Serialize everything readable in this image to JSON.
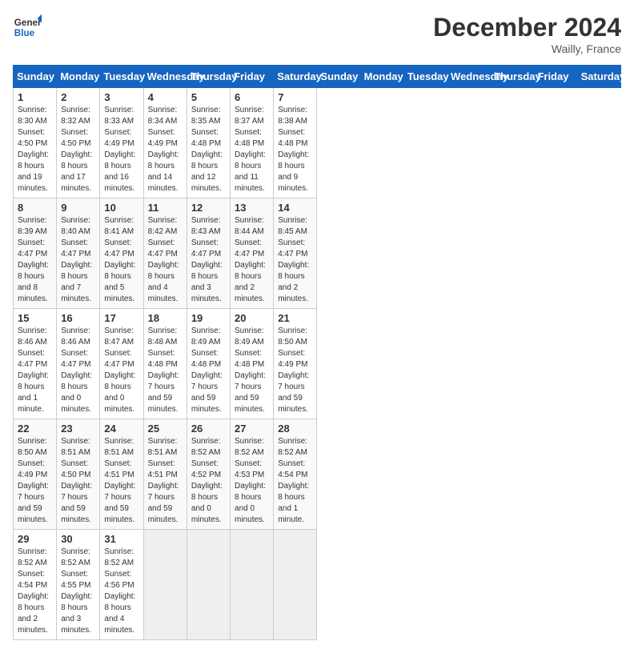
{
  "header": {
    "logo_general": "General",
    "logo_blue": "Blue",
    "month_title": "December 2024",
    "location": "Wailly, France"
  },
  "days_of_week": [
    "Sunday",
    "Monday",
    "Tuesday",
    "Wednesday",
    "Thursday",
    "Friday",
    "Saturday"
  ],
  "weeks": [
    [
      {
        "day": "1",
        "sunrise": "Sunrise: 8:30 AM",
        "sunset": "Sunset: 4:50 PM",
        "daylight": "Daylight: 8 hours and 19 minutes."
      },
      {
        "day": "2",
        "sunrise": "Sunrise: 8:32 AM",
        "sunset": "Sunset: 4:50 PM",
        "daylight": "Daylight: 8 hours and 17 minutes."
      },
      {
        "day": "3",
        "sunrise": "Sunrise: 8:33 AM",
        "sunset": "Sunset: 4:49 PM",
        "daylight": "Daylight: 8 hours and 16 minutes."
      },
      {
        "day": "4",
        "sunrise": "Sunrise: 8:34 AM",
        "sunset": "Sunset: 4:49 PM",
        "daylight": "Daylight: 8 hours and 14 minutes."
      },
      {
        "day": "5",
        "sunrise": "Sunrise: 8:35 AM",
        "sunset": "Sunset: 4:48 PM",
        "daylight": "Daylight: 8 hours and 12 minutes."
      },
      {
        "day": "6",
        "sunrise": "Sunrise: 8:37 AM",
        "sunset": "Sunset: 4:48 PM",
        "daylight": "Daylight: 8 hours and 11 minutes."
      },
      {
        "day": "7",
        "sunrise": "Sunrise: 8:38 AM",
        "sunset": "Sunset: 4:48 PM",
        "daylight": "Daylight: 8 hours and 9 minutes."
      }
    ],
    [
      {
        "day": "8",
        "sunrise": "Sunrise: 8:39 AM",
        "sunset": "Sunset: 4:47 PM",
        "daylight": "Daylight: 8 hours and 8 minutes."
      },
      {
        "day": "9",
        "sunrise": "Sunrise: 8:40 AM",
        "sunset": "Sunset: 4:47 PM",
        "daylight": "Daylight: 8 hours and 7 minutes."
      },
      {
        "day": "10",
        "sunrise": "Sunrise: 8:41 AM",
        "sunset": "Sunset: 4:47 PM",
        "daylight": "Daylight: 8 hours and 5 minutes."
      },
      {
        "day": "11",
        "sunrise": "Sunrise: 8:42 AM",
        "sunset": "Sunset: 4:47 PM",
        "daylight": "Daylight: 8 hours and 4 minutes."
      },
      {
        "day": "12",
        "sunrise": "Sunrise: 8:43 AM",
        "sunset": "Sunset: 4:47 PM",
        "daylight": "Daylight: 8 hours and 3 minutes."
      },
      {
        "day": "13",
        "sunrise": "Sunrise: 8:44 AM",
        "sunset": "Sunset: 4:47 PM",
        "daylight": "Daylight: 8 hours and 2 minutes."
      },
      {
        "day": "14",
        "sunrise": "Sunrise: 8:45 AM",
        "sunset": "Sunset: 4:47 PM",
        "daylight": "Daylight: 8 hours and 2 minutes."
      }
    ],
    [
      {
        "day": "15",
        "sunrise": "Sunrise: 8:46 AM",
        "sunset": "Sunset: 4:47 PM",
        "daylight": "Daylight: 8 hours and 1 minute."
      },
      {
        "day": "16",
        "sunrise": "Sunrise: 8:46 AM",
        "sunset": "Sunset: 4:47 PM",
        "daylight": "Daylight: 8 hours and 0 minutes."
      },
      {
        "day": "17",
        "sunrise": "Sunrise: 8:47 AM",
        "sunset": "Sunset: 4:47 PM",
        "daylight": "Daylight: 8 hours and 0 minutes."
      },
      {
        "day": "18",
        "sunrise": "Sunrise: 8:48 AM",
        "sunset": "Sunset: 4:48 PM",
        "daylight": "Daylight: 7 hours and 59 minutes."
      },
      {
        "day": "19",
        "sunrise": "Sunrise: 8:49 AM",
        "sunset": "Sunset: 4:48 PM",
        "daylight": "Daylight: 7 hours and 59 minutes."
      },
      {
        "day": "20",
        "sunrise": "Sunrise: 8:49 AM",
        "sunset": "Sunset: 4:48 PM",
        "daylight": "Daylight: 7 hours and 59 minutes."
      },
      {
        "day": "21",
        "sunrise": "Sunrise: 8:50 AM",
        "sunset": "Sunset: 4:49 PM",
        "daylight": "Daylight: 7 hours and 59 minutes."
      }
    ],
    [
      {
        "day": "22",
        "sunrise": "Sunrise: 8:50 AM",
        "sunset": "Sunset: 4:49 PM",
        "daylight": "Daylight: 7 hours and 59 minutes."
      },
      {
        "day": "23",
        "sunrise": "Sunrise: 8:51 AM",
        "sunset": "Sunset: 4:50 PM",
        "daylight": "Daylight: 7 hours and 59 minutes."
      },
      {
        "day": "24",
        "sunrise": "Sunrise: 8:51 AM",
        "sunset": "Sunset: 4:51 PM",
        "daylight": "Daylight: 7 hours and 59 minutes."
      },
      {
        "day": "25",
        "sunrise": "Sunrise: 8:51 AM",
        "sunset": "Sunset: 4:51 PM",
        "daylight": "Daylight: 7 hours and 59 minutes."
      },
      {
        "day": "26",
        "sunrise": "Sunrise: 8:52 AM",
        "sunset": "Sunset: 4:52 PM",
        "daylight": "Daylight: 8 hours and 0 minutes."
      },
      {
        "day": "27",
        "sunrise": "Sunrise: 8:52 AM",
        "sunset": "Sunset: 4:53 PM",
        "daylight": "Daylight: 8 hours and 0 minutes."
      },
      {
        "day": "28",
        "sunrise": "Sunrise: 8:52 AM",
        "sunset": "Sunset: 4:54 PM",
        "daylight": "Daylight: 8 hours and 1 minute."
      }
    ],
    [
      {
        "day": "29",
        "sunrise": "Sunrise: 8:52 AM",
        "sunset": "Sunset: 4:54 PM",
        "daylight": "Daylight: 8 hours and 2 minutes."
      },
      {
        "day": "30",
        "sunrise": "Sunrise: 8:52 AM",
        "sunset": "Sunset: 4:55 PM",
        "daylight": "Daylight: 8 hours and 3 minutes."
      },
      {
        "day": "31",
        "sunrise": "Sunrise: 8:52 AM",
        "sunset": "Sunset: 4:56 PM",
        "daylight": "Daylight: 8 hours and 4 minutes."
      },
      null,
      null,
      null,
      null
    ]
  ]
}
